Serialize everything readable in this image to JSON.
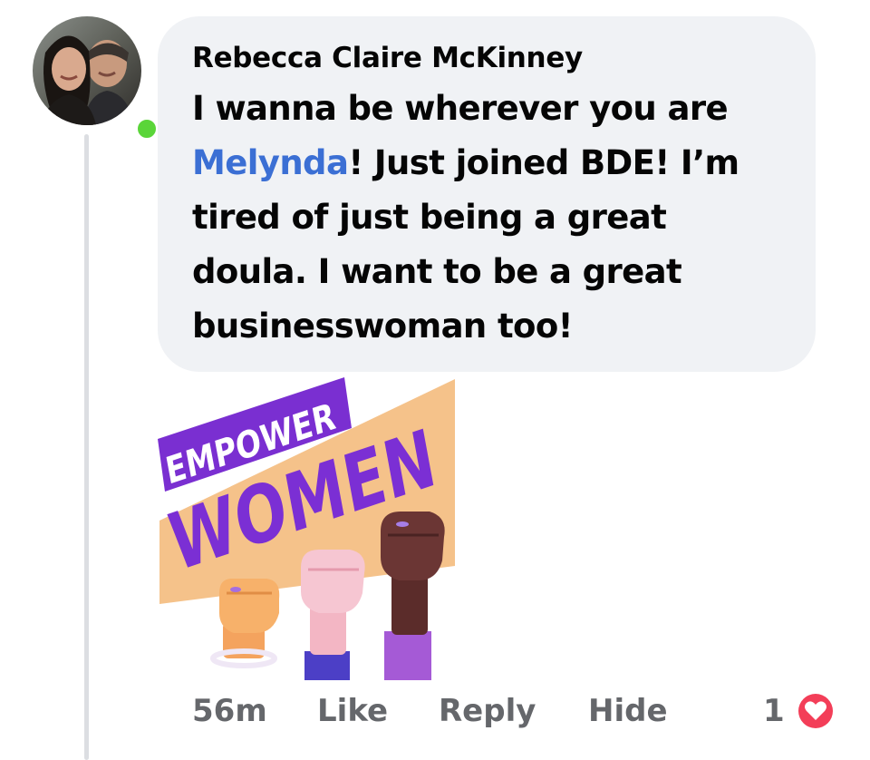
{
  "comment": {
    "author": "Rebecca Claire McKinney",
    "text_lines": [
      "I wanna be wherever you are",
      "! Just joined BDE! I’m",
      "tired of just being a great",
      "doula. I want to be a great",
      "businesswoman too!"
    ],
    "mention": "Melynda",
    "online_status_color": "#5ad539",
    "mention_color": "#3b6fd4"
  },
  "sticker": {
    "line1": "EMPOWER",
    "line2": "WOMEN"
  },
  "actions": {
    "time": "56m",
    "like": "Like",
    "reply": "Reply",
    "hide": "Hide"
  },
  "reactions": {
    "count": "1",
    "icon": "love-reaction-icon",
    "color": "#f33e58"
  }
}
